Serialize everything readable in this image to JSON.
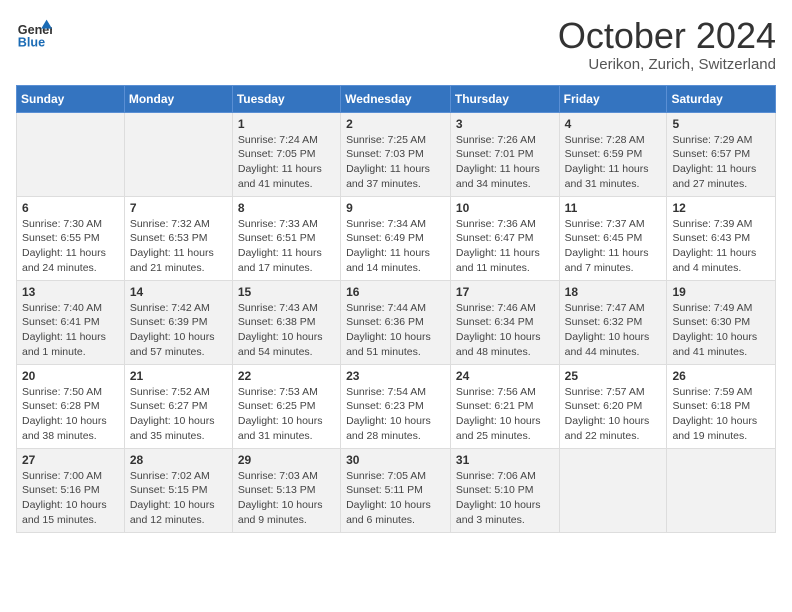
{
  "header": {
    "logo_line1": "General",
    "logo_line2": "Blue",
    "month_year": "October 2024",
    "location": "Uerikon, Zurich, Switzerland"
  },
  "weekdays": [
    "Sunday",
    "Monday",
    "Tuesday",
    "Wednesday",
    "Thursday",
    "Friday",
    "Saturday"
  ],
  "weeks": [
    [
      {
        "day": "",
        "text": ""
      },
      {
        "day": "",
        "text": ""
      },
      {
        "day": "1",
        "text": "Sunrise: 7:24 AM\nSunset: 7:05 PM\nDaylight: 11 hours and 41 minutes."
      },
      {
        "day": "2",
        "text": "Sunrise: 7:25 AM\nSunset: 7:03 PM\nDaylight: 11 hours and 37 minutes."
      },
      {
        "day": "3",
        "text": "Sunrise: 7:26 AM\nSunset: 7:01 PM\nDaylight: 11 hours and 34 minutes."
      },
      {
        "day": "4",
        "text": "Sunrise: 7:28 AM\nSunset: 6:59 PM\nDaylight: 11 hours and 31 minutes."
      },
      {
        "day": "5",
        "text": "Sunrise: 7:29 AM\nSunset: 6:57 PM\nDaylight: 11 hours and 27 minutes."
      }
    ],
    [
      {
        "day": "6",
        "text": "Sunrise: 7:30 AM\nSunset: 6:55 PM\nDaylight: 11 hours and 24 minutes."
      },
      {
        "day": "7",
        "text": "Sunrise: 7:32 AM\nSunset: 6:53 PM\nDaylight: 11 hours and 21 minutes."
      },
      {
        "day": "8",
        "text": "Sunrise: 7:33 AM\nSunset: 6:51 PM\nDaylight: 11 hours and 17 minutes."
      },
      {
        "day": "9",
        "text": "Sunrise: 7:34 AM\nSunset: 6:49 PM\nDaylight: 11 hours and 14 minutes."
      },
      {
        "day": "10",
        "text": "Sunrise: 7:36 AM\nSunset: 6:47 PM\nDaylight: 11 hours and 11 minutes."
      },
      {
        "day": "11",
        "text": "Sunrise: 7:37 AM\nSunset: 6:45 PM\nDaylight: 11 hours and 7 minutes."
      },
      {
        "day": "12",
        "text": "Sunrise: 7:39 AM\nSunset: 6:43 PM\nDaylight: 11 hours and 4 minutes."
      }
    ],
    [
      {
        "day": "13",
        "text": "Sunrise: 7:40 AM\nSunset: 6:41 PM\nDaylight: 11 hours and 1 minute."
      },
      {
        "day": "14",
        "text": "Sunrise: 7:42 AM\nSunset: 6:39 PM\nDaylight: 10 hours and 57 minutes."
      },
      {
        "day": "15",
        "text": "Sunrise: 7:43 AM\nSunset: 6:38 PM\nDaylight: 10 hours and 54 minutes."
      },
      {
        "day": "16",
        "text": "Sunrise: 7:44 AM\nSunset: 6:36 PM\nDaylight: 10 hours and 51 minutes."
      },
      {
        "day": "17",
        "text": "Sunrise: 7:46 AM\nSunset: 6:34 PM\nDaylight: 10 hours and 48 minutes."
      },
      {
        "day": "18",
        "text": "Sunrise: 7:47 AM\nSunset: 6:32 PM\nDaylight: 10 hours and 44 minutes."
      },
      {
        "day": "19",
        "text": "Sunrise: 7:49 AM\nSunset: 6:30 PM\nDaylight: 10 hours and 41 minutes."
      }
    ],
    [
      {
        "day": "20",
        "text": "Sunrise: 7:50 AM\nSunset: 6:28 PM\nDaylight: 10 hours and 38 minutes."
      },
      {
        "day": "21",
        "text": "Sunrise: 7:52 AM\nSunset: 6:27 PM\nDaylight: 10 hours and 35 minutes."
      },
      {
        "day": "22",
        "text": "Sunrise: 7:53 AM\nSunset: 6:25 PM\nDaylight: 10 hours and 31 minutes."
      },
      {
        "day": "23",
        "text": "Sunrise: 7:54 AM\nSunset: 6:23 PM\nDaylight: 10 hours and 28 minutes."
      },
      {
        "day": "24",
        "text": "Sunrise: 7:56 AM\nSunset: 6:21 PM\nDaylight: 10 hours and 25 minutes."
      },
      {
        "day": "25",
        "text": "Sunrise: 7:57 AM\nSunset: 6:20 PM\nDaylight: 10 hours and 22 minutes."
      },
      {
        "day": "26",
        "text": "Sunrise: 7:59 AM\nSunset: 6:18 PM\nDaylight: 10 hours and 19 minutes."
      }
    ],
    [
      {
        "day": "27",
        "text": "Sunrise: 7:00 AM\nSunset: 5:16 PM\nDaylight: 10 hours and 15 minutes."
      },
      {
        "day": "28",
        "text": "Sunrise: 7:02 AM\nSunset: 5:15 PM\nDaylight: 10 hours and 12 minutes."
      },
      {
        "day": "29",
        "text": "Sunrise: 7:03 AM\nSunset: 5:13 PM\nDaylight: 10 hours and 9 minutes."
      },
      {
        "day": "30",
        "text": "Sunrise: 7:05 AM\nSunset: 5:11 PM\nDaylight: 10 hours and 6 minutes."
      },
      {
        "day": "31",
        "text": "Sunrise: 7:06 AM\nSunset: 5:10 PM\nDaylight: 10 hours and 3 minutes."
      },
      {
        "day": "",
        "text": ""
      },
      {
        "day": "",
        "text": ""
      }
    ]
  ]
}
